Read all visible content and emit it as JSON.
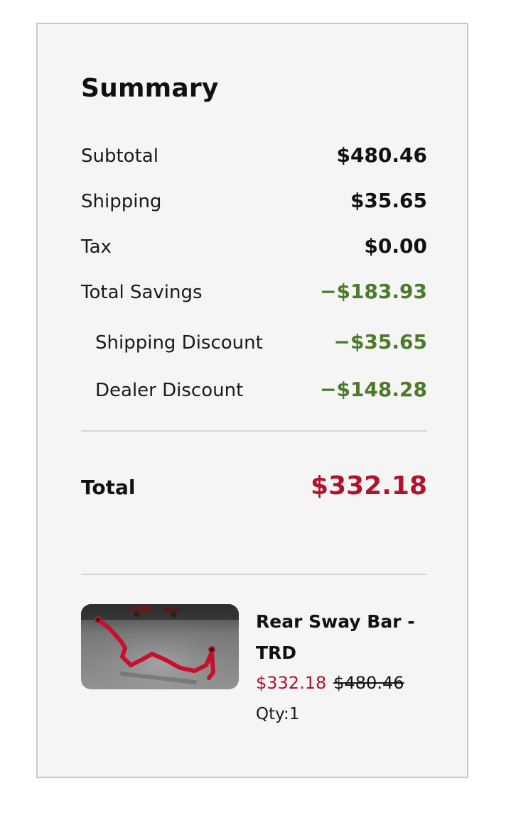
{
  "summary": {
    "title": "Summary",
    "rows": [
      {
        "label": "Subtotal",
        "value": "$480.46"
      },
      {
        "label": "Shipping",
        "value": "$35.65"
      },
      {
        "label": "Tax",
        "value": "$0.00"
      },
      {
        "label": "Total Savings",
        "value": "−$183.93"
      },
      {
        "label": "Shipping Discount",
        "value": "−$35.65"
      },
      {
        "label": "Dealer Discount",
        "value": "−$148.28"
      }
    ],
    "total": {
      "label": "Total",
      "value": "$332.18"
    }
  },
  "product": {
    "name": "Rear Sway Bar - TRD",
    "sale_price": "$332.18",
    "original_price": "$480.46",
    "qty": "Qty:1",
    "image_icon": "sway-bar-image"
  },
  "colors": {
    "savings": "#4a7a2a",
    "total": "#b0142a",
    "background": "#f5f5f5",
    "border": "#c9c9c9"
  }
}
